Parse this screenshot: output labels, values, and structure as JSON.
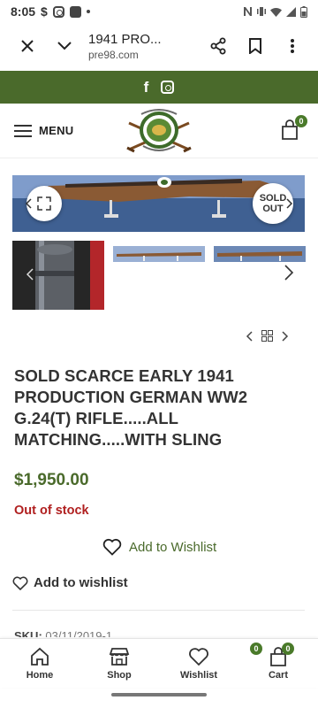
{
  "status_bar": {
    "time": "8:05"
  },
  "browser": {
    "page_title": "1941 PRO...",
    "domain": "pre98.com"
  },
  "header": {
    "menu_label": "MENU",
    "cart_count": "0"
  },
  "gallery": {
    "sold_label_line1": "SOLD",
    "sold_label_line2": "OUT"
  },
  "product": {
    "title": "SOLD SCARCE EARLY 1941 PRODUCTION GERMAN WW2 G.24(t) RIFLE.....ALL MATCHING.....WITH SLING",
    "price": "$1,950.00",
    "stock_status": "Out of stock",
    "wishlist_primary": "Add to Wishlist",
    "wishlist_secondary": "Add to wishlist",
    "sku_label": "SKU:",
    "sku_value": "03/11/2019-1"
  },
  "bottom_nav": {
    "home": "Home",
    "shop": "Shop",
    "wishlist": "Wishlist",
    "wishlist_count": "0",
    "cart": "Cart",
    "cart_count": "0"
  },
  "colors": {
    "brand_green": "#4a6a2b",
    "out_of_stock_red": "#b01f1f",
    "badge_green": "#4a7a2a"
  },
  "icons": [
    "close-icon",
    "chevron-down-icon",
    "share-icon",
    "bookmark-icon",
    "more-vert-icon",
    "facebook-icon",
    "instagram-icon",
    "menu-icon",
    "cart-icon",
    "expand-icon",
    "chevron-left-icon",
    "chevron-right-icon",
    "grid-icon",
    "heart-icon",
    "home-icon",
    "shop-icon"
  ]
}
